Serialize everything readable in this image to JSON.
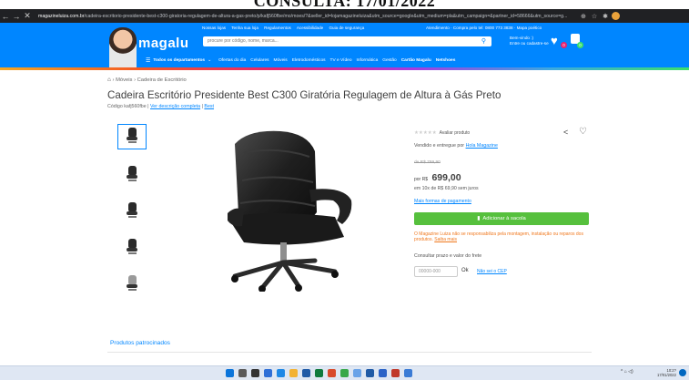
{
  "caption": "CONSULTA: 17/01/2022",
  "browser": {
    "url_host": "magazineluiza.com.br",
    "url_rest": "/cadeira-escritorio-presidente-best-c300-giratoria-regulagem-de-altura-a-gas-preto/p/kafj560fbe/mo/moes/?&seller_id=lojamagazineluiza&utm_source=google&utm_medium=pla&utm_campaign=&partner_id=58666&utm_source=g..."
  },
  "header": {
    "top_links": [
      "Nossas lojas",
      "Tenha sua loja",
      "Regulamentos",
      "Acessibilidade",
      "Guia de segurança"
    ],
    "service_text": "Atendimento · Compra pelo tel: 0800 773 3838 · Mapa poético",
    "logo": "magalu",
    "search_placeholder": "procure por código, nome, marca...",
    "location_line1": "Bem-vindo :)",
    "location_line2": "Entre ou cadastre-se",
    "wishlist_count": "0",
    "cart_count": "0"
  },
  "categories": {
    "all_label": "Todos os departamentos",
    "links": [
      "Ofertas do dia",
      "Celulares",
      "Móveis",
      "Eletrodomésticos",
      "TV e Vídeo",
      "Informática",
      "Gestão"
    ],
    "bold_links": [
      "Cartão Magalu",
      "Netshoes"
    ]
  },
  "breadcrumb": {
    "items": [
      "Móveis",
      "Cadeira de Escritório"
    ]
  },
  "product": {
    "title": "Cadeira Escritório Presidente Best C300 Giratória Regulagem de Altura à Gás Preto",
    "code": "Código kafj560fbe",
    "see_description": "Ver descrição completa",
    "brand": "Best"
  },
  "buybox": {
    "stars": "★★★★★",
    "rate_label": "Avaliar produto",
    "seller_prefix": "Vendido e entregue por",
    "seller_name": "Hola Magazine",
    "old_price": "de R$ 799,90",
    "price_prefix": "por R$",
    "price": "699,00",
    "installments": "em 10x de R$ 69,90 sem juros",
    "more_payment": "Mais formas de pagamento",
    "add_button": "Adicionar à sacola",
    "warning": "O Magazine Luiza não se responsabiliza pela montagem, instalação ou reparos dos produtos.",
    "warning_link": "Saiba mais",
    "freight_label": "Consultar prazo e valor do frete",
    "cep_placeholder": "00000-000",
    "ok_label": "Ok",
    "no_cep": "Não sei o CEP"
  },
  "sponsored": "Produtos patrocinados",
  "taskbar": {
    "tray": "^ ⌂ ◁)",
    "time": "10:2?",
    "date": "17/01/2022"
  }
}
